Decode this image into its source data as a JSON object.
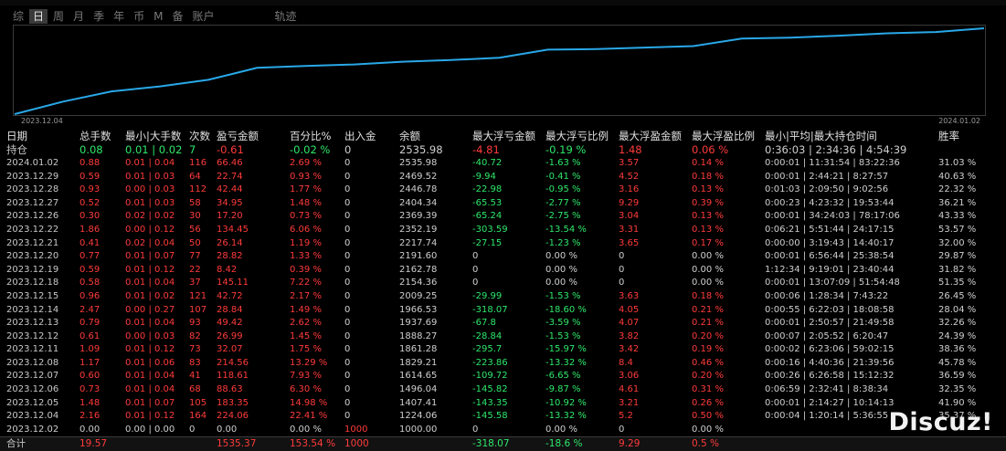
{
  "tabs": [
    {
      "label": "综",
      "active": false
    },
    {
      "label": "日",
      "active": true
    },
    {
      "label": "周",
      "active": false
    },
    {
      "label": "月",
      "active": false
    },
    {
      "label": "季",
      "active": false
    },
    {
      "label": "年",
      "active": false
    },
    {
      "label": "币",
      "active": false
    },
    {
      "label": "M",
      "active": false
    },
    {
      "label": "备",
      "active": false
    },
    {
      "label": "账户",
      "active": false
    }
  ],
  "trace_tab": "轨迹",
  "chart_data": {
    "type": "line",
    "x": [
      "2023.12.04",
      "2023.12.05",
      "2023.12.06",
      "2023.12.07",
      "2023.12.08",
      "2023.12.11",
      "2023.12.12",
      "2023.12.13",
      "2023.12.14",
      "2023.12.15",
      "2023.12.18",
      "2023.12.19",
      "2023.12.20",
      "2023.12.21",
      "2023.12.22",
      "2023.12.26",
      "2023.12.27",
      "2023.12.28",
      "2023.12.29",
      "2024.01.02"
    ],
    "values": [
      1224.06,
      1407.41,
      1496.04,
      1614.65,
      1829.21,
      1861.28,
      1888.27,
      1937.69,
      1966.53,
      2009.25,
      2154.36,
      2162.78,
      2191.6,
      2217.74,
      2352.19,
      2369.39,
      2404.34,
      2446.78,
      2469.52,
      2535.98
    ],
    "baseline": 1000,
    "x_start_label": "2023.12.04",
    "x_end_label": "2024.01.02",
    "color": "#29a8e8"
  },
  "columns": [
    "日期",
    "总手数",
    "最小|大手数",
    "次数",
    "盈亏金额",
    "百分比%",
    "出入金",
    "余额",
    "最大浮亏金额",
    "最大浮亏比例",
    "最大浮盈金额",
    "最大浮盈比例",
    "最小|平均|最大持仓时间",
    "胜率"
  ],
  "holding": {
    "date": "持仓",
    "lots": "0.08",
    "minmax": "0.01 | 0.02",
    "count": "7",
    "pnl": "-0.61",
    "pct": "-0.02 %",
    "flow": "0",
    "balance": "2535.98",
    "max_float_loss": "-4.81",
    "max_float_loss_pct": "-0.19 %",
    "max_float_profit": "1.48",
    "max_float_profit_pct": "0.06 %",
    "hold_time": "0:36:03 | 2:34:36 | 4:54:39",
    "win_rate": ""
  },
  "rows": [
    {
      "date": "2024.01.02",
      "lots": "0.88",
      "minmax": "0.01 | 0.04",
      "count": "116",
      "pnl": "66.46",
      "pct": "2.69 %",
      "flow": "0",
      "balance": "2535.98",
      "max_float_loss": "-40.72",
      "max_float_loss_pct": "-1.63 %",
      "max_float_profit": "3.57",
      "max_float_profit_pct": "0.14 %",
      "hold_time": "0:00:01 | 11:31:54 | 83:22:36",
      "win_rate": "31.03 %"
    },
    {
      "date": "2023.12.29",
      "lots": "0.59",
      "minmax": "0.01 | 0.03",
      "count": "64",
      "pnl": "22.74",
      "pct": "0.93 %",
      "flow": "0",
      "balance": "2469.52",
      "max_float_loss": "-9.94",
      "max_float_loss_pct": "-0.41 %",
      "max_float_profit": "4.52",
      "max_float_profit_pct": "0.18 %",
      "hold_time": "0:00:01 | 2:44:21 | 8:27:57",
      "win_rate": "40.63 %"
    },
    {
      "date": "2023.12.28",
      "lots": "0.93",
      "minmax": "0.00 | 0.03",
      "count": "112",
      "pnl": "42.44",
      "pct": "1.77 %",
      "flow": "0",
      "balance": "2446.78",
      "max_float_loss": "-22.98",
      "max_float_loss_pct": "-0.95 %",
      "max_float_profit": "3.16",
      "max_float_profit_pct": "0.13 %",
      "hold_time": "0:01:03 | 2:09:50 | 9:02:56",
      "win_rate": "22.32 %"
    },
    {
      "date": "2023.12.27",
      "lots": "0.52",
      "minmax": "0.01 | 0.03",
      "count": "58",
      "pnl": "34.95",
      "pct": "1.48 %",
      "flow": "0",
      "balance": "2404.34",
      "max_float_loss": "-65.53",
      "max_float_loss_pct": "-2.77 %",
      "max_float_profit": "9.29",
      "max_float_profit_pct": "0.39 %",
      "hold_time": "0:00:23 | 4:23:32 | 19:53:44",
      "win_rate": "36.21 %"
    },
    {
      "date": "2023.12.26",
      "lots": "0.30",
      "minmax": "0.02 | 0.02",
      "count": "30",
      "pnl": "17.20",
      "pct": "0.73 %",
      "flow": "0",
      "balance": "2369.39",
      "max_float_loss": "-65.24",
      "max_float_loss_pct": "-2.75 %",
      "max_float_profit": "3.04",
      "max_float_profit_pct": "0.13 %",
      "hold_time": "0:00:01 | 34:24:03 | 78:17:06",
      "win_rate": "43.33 %"
    },
    {
      "date": "2023.12.22",
      "lots": "1.86",
      "minmax": "0.00 | 0.12",
      "count": "56",
      "pnl": "134.45",
      "pct": "6.06 %",
      "flow": "0",
      "balance": "2352.19",
      "max_float_loss": "-303.59",
      "max_float_loss_pct": "-13.54 %",
      "max_float_profit": "3.31",
      "max_float_profit_pct": "0.13 %",
      "hold_time": "0:06:21 | 5:51:44 | 24:17:15",
      "win_rate": "53.57 %"
    },
    {
      "date": "2023.12.21",
      "lots": "0.41",
      "minmax": "0.02 | 0.04",
      "count": "50",
      "pnl": "26.14",
      "pct": "1.19 %",
      "flow": "0",
      "balance": "2217.74",
      "max_float_loss": "-27.15",
      "max_float_loss_pct": "-1.23 %",
      "max_float_profit": "3.65",
      "max_float_profit_pct": "0.17 %",
      "hold_time": "0:00:00 | 3:19:43 | 14:40:17",
      "win_rate": "32.00 %"
    },
    {
      "date": "2023.12.20",
      "lots": "0.77",
      "minmax": "0.01 | 0.07",
      "count": "77",
      "pnl": "28.82",
      "pct": "1.33 %",
      "flow": "0",
      "balance": "2191.60",
      "max_float_loss": "0",
      "max_float_loss_pct": "0.00 %",
      "max_float_profit": "0",
      "max_float_profit_pct": "0.00 %",
      "hold_time": "0:00:01 | 6:56:44 | 25:38:54",
      "win_rate": "29.87 %"
    },
    {
      "date": "2023.12.19",
      "lots": "0.59",
      "minmax": "0.01 | 0.12",
      "count": "22",
      "pnl": "8.42",
      "pct": "0.39 %",
      "flow": "0",
      "balance": "2162.78",
      "max_float_loss": "0",
      "max_float_loss_pct": "0.00 %",
      "max_float_profit": "0",
      "max_float_profit_pct": "0.00 %",
      "hold_time": "1:12:34 | 9:19:01 | 23:40:44",
      "win_rate": "31.82 %"
    },
    {
      "date": "2023.12.18",
      "lots": "0.58",
      "minmax": "0.01 | 0.04",
      "count": "37",
      "pnl": "145.11",
      "pct": "7.22 %",
      "flow": "0",
      "balance": "2154.36",
      "max_float_loss": "0",
      "max_float_loss_pct": "0.00 %",
      "max_float_profit": "0",
      "max_float_profit_pct": "0.00 %",
      "hold_time": "0:00:01 | 13:07:09 | 51:54:48",
      "win_rate": "51.35 %"
    },
    {
      "date": "2023.12.15",
      "lots": "0.96",
      "minmax": "0.01 | 0.02",
      "count": "121",
      "pnl": "42.72",
      "pct": "2.17 %",
      "flow": "0",
      "balance": "2009.25",
      "max_float_loss": "-29.99",
      "max_float_loss_pct": "-1.53 %",
      "max_float_profit": "3.63",
      "max_float_profit_pct": "0.18 %",
      "hold_time": "0:00:06 | 1:28:34 | 7:43:22",
      "win_rate": "26.45 %"
    },
    {
      "date": "2023.12.14",
      "lots": "2.47",
      "minmax": "0.00 | 0.27",
      "count": "107",
      "pnl": "28.84",
      "pct": "1.49 %",
      "flow": "0",
      "balance": "1966.53",
      "max_float_loss": "-318.07",
      "max_float_loss_pct": "-18.60 %",
      "max_float_profit": "4.05",
      "max_float_profit_pct": "0.21 %",
      "hold_time": "0:00:55 | 6:22:03 | 18:08:58",
      "win_rate": "28.04 %"
    },
    {
      "date": "2023.12.13",
      "lots": "0.79",
      "minmax": "0.01 | 0.04",
      "count": "93",
      "pnl": "49.42",
      "pct": "2.62 %",
      "flow": "0",
      "balance": "1937.69",
      "max_float_loss": "-67.8",
      "max_float_loss_pct": "-3.59 %",
      "max_float_profit": "4.07",
      "max_float_profit_pct": "0.21 %",
      "hold_time": "0:00:01 | 2:50:57 | 21:49:58",
      "win_rate": "32.26 %"
    },
    {
      "date": "2023.12.12",
      "lots": "0.61",
      "minmax": "0.00 | 0.03",
      "count": "82",
      "pnl": "26.99",
      "pct": "1.45 %",
      "flow": "0",
      "balance": "1888.27",
      "max_float_loss": "-28.84",
      "max_float_loss_pct": "-1.53 %",
      "max_float_profit": "3.82",
      "max_float_profit_pct": "0.20 %",
      "hold_time": "0:00:07 | 2:05:52 | 6:20:47",
      "win_rate": "24.39 %"
    },
    {
      "date": "2023.12.11",
      "lots": "1.09",
      "minmax": "0.01 | 0.12",
      "count": "73",
      "pnl": "32.07",
      "pct": "1.75 %",
      "flow": "0",
      "balance": "1861.28",
      "max_float_loss": "-295.7",
      "max_float_loss_pct": "-15.97 %",
      "max_float_profit": "3.42",
      "max_float_profit_pct": "0.19 %",
      "hold_time": "0:00:02 | 6:23:06 | 59:02:15",
      "win_rate": "38.36 %"
    },
    {
      "date": "2023.12.08",
      "lots": "1.17",
      "minmax": "0.01 | 0.06",
      "count": "83",
      "pnl": "214.56",
      "pct": "13.29 %",
      "flow": "0",
      "balance": "1829.21",
      "max_float_loss": "-223.86",
      "max_float_loss_pct": "-13.32 %",
      "max_float_profit": "8.4",
      "max_float_profit_pct": "0.46 %",
      "hold_time": "0:00:16 | 4:40:36 | 21:39:56",
      "win_rate": "45.78 %"
    },
    {
      "date": "2023.12.07",
      "lots": "0.60",
      "minmax": "0.01 | 0.04",
      "count": "41",
      "pnl": "118.61",
      "pct": "7.93 %",
      "flow": "0",
      "balance": "1614.65",
      "max_float_loss": "-109.72",
      "max_float_loss_pct": "-6.65 %",
      "max_float_profit": "3.06",
      "max_float_profit_pct": "0.20 %",
      "hold_time": "0:00:26 | 6:26:58 | 15:12:32",
      "win_rate": "36.59 %"
    },
    {
      "date": "2023.12.06",
      "lots": "0.73",
      "minmax": "0.01 | 0.04",
      "count": "68",
      "pnl": "88.63",
      "pct": "6.30 %",
      "flow": "0",
      "balance": "1496.04",
      "max_float_loss": "-145.82",
      "max_float_loss_pct": "-9.87 %",
      "max_float_profit": "4.61",
      "max_float_profit_pct": "0.31 %",
      "hold_time": "0:06:59 | 2:32:41 | 8:38:34",
      "win_rate": "32.35 %"
    },
    {
      "date": "2023.12.05",
      "lots": "1.48",
      "minmax": "0.01 | 0.07",
      "count": "105",
      "pnl": "183.35",
      "pct": "14.98 %",
      "flow": "0",
      "balance": "1407.41",
      "max_float_loss": "-143.35",
      "max_float_loss_pct": "-10.92 %",
      "max_float_profit": "3.21",
      "max_float_profit_pct": "0.26 %",
      "hold_time": "0:00:01 | 2:14:27 | 10:14:13",
      "win_rate": "41.90 %"
    },
    {
      "date": "2023.12.04",
      "lots": "2.16",
      "minmax": "0.01 | 0.12",
      "count": "164",
      "pnl": "224.06",
      "pct": "22.41 %",
      "flow": "0",
      "balance": "1224.06",
      "max_float_loss": "-145.58",
      "max_float_loss_pct": "-13.32 %",
      "max_float_profit": "5.2",
      "max_float_profit_pct": "0.50 %",
      "hold_time": "0:00:04 | 1:20:14 | 5:36:55",
      "win_rate": "35.37 %"
    },
    {
      "date": "2023.12.02",
      "lots": "0.00",
      "minmax": "0.00 | 0.00",
      "count": "0",
      "pnl": "0.00",
      "pct": "0.00 %",
      "flow": "1000",
      "balance": "1000.00",
      "max_float_loss": "0",
      "max_float_loss_pct": "0.00 %",
      "max_float_profit": "0",
      "max_float_profit_pct": "0.00 %",
      "hold_time": "",
      "win_rate": ""
    }
  ],
  "total": {
    "date": "合计",
    "lots": "19.57",
    "minmax": "",
    "count": "",
    "pnl": "1535.37",
    "pct": "153.54 %",
    "flow": "1000",
    "balance": "",
    "max_float_loss": "-318.07",
    "max_float_loss_pct": "-18.6 %",
    "max_float_profit": "9.29",
    "max_float_profit_pct": "0.5 %",
    "hold_time": "",
    "win_rate": ""
  },
  "watermark": "Discuz!"
}
